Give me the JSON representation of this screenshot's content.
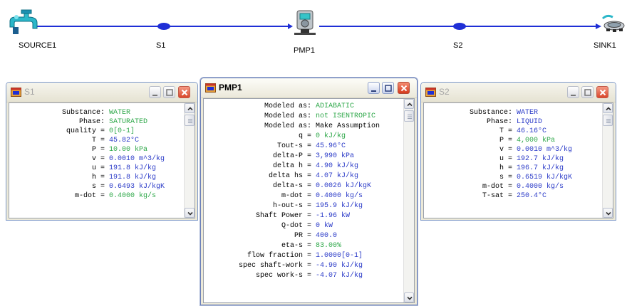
{
  "diagram": {
    "nodes": [
      {
        "id": "SOURCE1",
        "label": "SOURCE1"
      },
      {
        "id": "S1",
        "label": "S1"
      },
      {
        "id": "PMP1",
        "label": "PMP1"
      },
      {
        "id": "S2",
        "label": "S2"
      },
      {
        "id": "SINK1",
        "label": "SINK1"
      }
    ],
    "line_color": "#1f2fd6"
  },
  "windows": {
    "s1": {
      "title": "S1",
      "rows": [
        {
          "label": "Substance:",
          "value": "WATER",
          "color": "green"
        },
        {
          "label": "Phase:",
          "value": "SATURATED",
          "color": "green"
        },
        {
          "label": "quality =",
          "value": "0[0-1]",
          "color": "green"
        },
        {
          "label": "T =",
          "value": "45.82°C",
          "color": "blue"
        },
        {
          "label": "P =",
          "value": "10.00 kPa",
          "color": "green"
        },
        {
          "label": "v =",
          "value": "0.0010 m^3/kg",
          "color": "blue"
        },
        {
          "label": "u =",
          "value": "191.8 kJ/kg",
          "color": "blue"
        },
        {
          "label": "h =",
          "value": "191.8 kJ/kg",
          "color": "blue"
        },
        {
          "label": "s =",
          "value": "0.6493 kJ/kgK",
          "color": "blue"
        },
        {
          "label": "m-dot =",
          "value": "0.4000 kg/s",
          "color": "green"
        }
      ]
    },
    "pmp1": {
      "title": "PMP1",
      "rows": [
        {
          "label": "Modeled as:",
          "value": "ADIABATIC",
          "color": "green"
        },
        {
          "label": "Modeled as:",
          "value": "not ISENTROPIC",
          "color": "green"
        },
        {
          "label": "Modeled as:",
          "value": "Make Assumption",
          "color": "black"
        },
        {
          "label": "q =",
          "value": "0 kJ/kg",
          "color": "green"
        },
        {
          "label": "Tout-s =",
          "value": "45.96°C",
          "color": "blue"
        },
        {
          "label": "delta-P =",
          "value": "3,990 kPa",
          "color": "blue"
        },
        {
          "label": "delta h =",
          "value": "4.90 kJ/kg",
          "color": "blue"
        },
        {
          "label": "delta hs =",
          "value": "4.07 kJ/kg",
          "color": "blue"
        },
        {
          "label": "delta-s =",
          "value": "0.0026 kJ/kgK",
          "color": "blue"
        },
        {
          "label": "m-dot =",
          "value": "0.4000 kg/s",
          "color": "blue"
        },
        {
          "label": "h-out-s =",
          "value": "195.9 kJ/kg",
          "color": "blue"
        },
        {
          "label": "Shaft Power =",
          "value": "-1.96 kW",
          "color": "blue"
        },
        {
          "label": "Q-dot =",
          "value": "0 kW",
          "color": "blue"
        },
        {
          "label": "PR =",
          "value": "400.0",
          "color": "blue"
        },
        {
          "label": "eta-s =",
          "value": "83.00%",
          "color": "green"
        },
        {
          "label": "flow fraction =",
          "value": "1.0000[0-1]",
          "color": "blue"
        },
        {
          "label": "spec shaft-work =",
          "value": "-4.90 kJ/kg",
          "color": "blue"
        },
        {
          "label": "spec work-s =",
          "value": "-4.07 kJ/kg",
          "color": "blue"
        }
      ]
    },
    "s2": {
      "title": "S2",
      "rows": [
        {
          "label": "Substance:",
          "value": "WATER",
          "color": "blue"
        },
        {
          "label": "Phase:",
          "value": "LIQUID",
          "color": "blue"
        },
        {
          "label": "T =",
          "value": "46.16°C",
          "color": "blue"
        },
        {
          "label": "P =",
          "value": "4,000 kPa",
          "color": "green"
        },
        {
          "label": "v =",
          "value": "0.0010 m^3/kg",
          "color": "blue"
        },
        {
          "label": "u =",
          "value": "192.7 kJ/kg",
          "color": "blue"
        },
        {
          "label": "h =",
          "value": "196.7 kJ/kg",
          "color": "blue"
        },
        {
          "label": "s =",
          "value": "0.6519 kJ/kgK",
          "color": "blue"
        },
        {
          "label": "m-dot =",
          "value": "0.4000 kg/s",
          "color": "blue"
        },
        {
          "label": "T-sat =",
          "value": "250.4°C",
          "color": "blue"
        }
      ]
    }
  },
  "icons": {
    "source": "faucet-icon",
    "pump": "pump-icon",
    "sink": "sink-drain-icon",
    "window": "window-app-icon",
    "minimize": "minimize-icon",
    "maximize": "maximize-icon",
    "close": "close-icon",
    "scroll_up": "scroll-up-arrow-icon",
    "scroll_down": "scroll-down-arrow-icon"
  },
  "colors": {
    "green": "#2fa84a",
    "blue": "#2b3bc8",
    "line": "#1f2fd6"
  }
}
